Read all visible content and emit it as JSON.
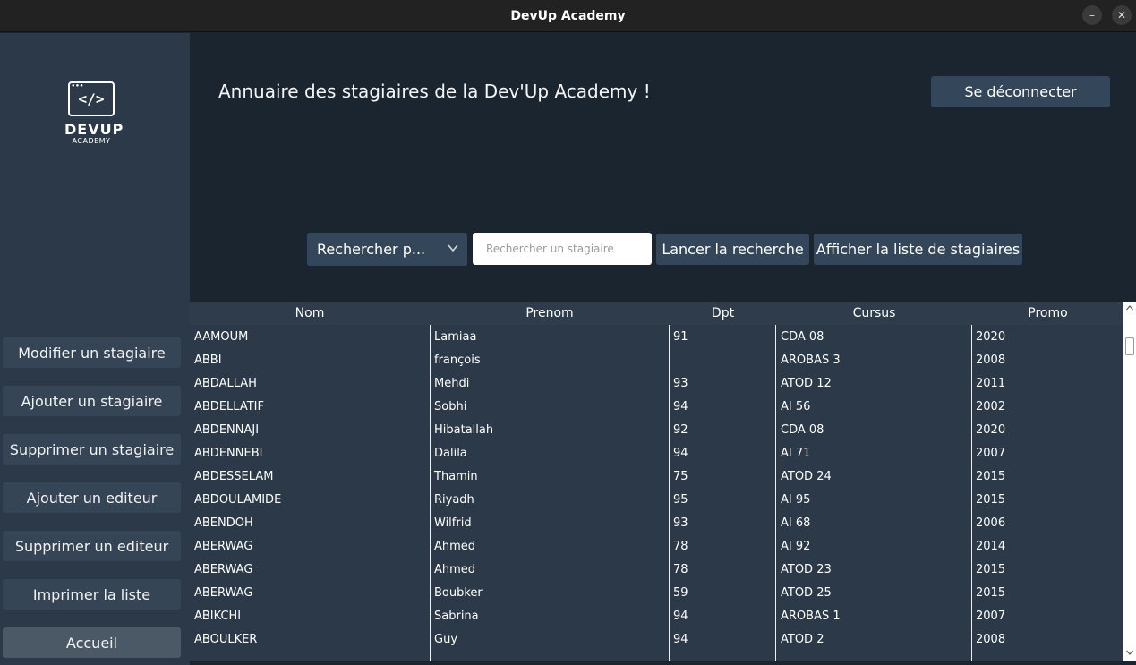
{
  "window": {
    "title": "DevUp Academy"
  },
  "sidebar": {
    "logo": {
      "code": "</>",
      "brand": "DEVUP",
      "sub": "ACADEMY"
    },
    "buttons": [
      {
        "label": "Modifier un stagiaire"
      },
      {
        "label": "Ajouter un stagiaire"
      },
      {
        "label": "Supprimer un stagiaire"
      },
      {
        "label": "Ajouter un editeur"
      },
      {
        "label": "Supprimer un editeur"
      },
      {
        "label": "Imprimer la liste"
      },
      {
        "label": "Accueil"
      }
    ]
  },
  "header": {
    "heading": "Annuaire des stagiaires de la Dev'Up Academy !",
    "logout_label": "Se déconnecter"
  },
  "search": {
    "select_value": "Rechercher p...",
    "input_placeholder": "Rechercher un stagiaire",
    "launch_label": "Lancer la recherche",
    "show_list_label": "Afficher la liste de stagiaires"
  },
  "table": {
    "columns": [
      "Nom",
      "Prenom",
      "Dpt",
      "Cursus",
      "Promo"
    ],
    "rows": [
      [
        "AAMOUM",
        "Lamiaa",
        "91",
        "CDA 08",
        "2020"
      ],
      [
        "ABBI",
        "françois",
        "",
        "AROBAS 3",
        "2008"
      ],
      [
        "ABDALLAH",
        "Mehdi",
        "93",
        "ATOD 12",
        "2011"
      ],
      [
        "ABDELLATIF",
        "Sobhi",
        "94",
        "AI 56",
        "2002"
      ],
      [
        "ABDENNAJI",
        "Hibatallah",
        "92",
        "CDA 08",
        "2020"
      ],
      [
        "ABDENNEBI",
        "Dalila",
        "94",
        "AI 71",
        "2007"
      ],
      [
        "ABDESSELAM",
        "Thamin",
        "75",
        "ATOD 24",
        "2015"
      ],
      [
        "ABDOULAMIDE",
        "Riyadh",
        "95",
        "AI 95",
        "2015"
      ],
      [
        "ABENDOH",
        "Wilfrid",
        "93",
        "AI 68",
        "2006"
      ],
      [
        "ABERWAG",
        "Ahmed",
        "78",
        "AI 92",
        "2014"
      ],
      [
        "ABERWAG",
        "Ahmed",
        "78",
        "ATOD 23",
        "2015"
      ],
      [
        "ABERWAG",
        "Boubker",
        "59",
        "ATOD 25",
        "2015"
      ],
      [
        "ABIKCHI",
        "Sabrina",
        "94",
        "AROBAS 1",
        "2007"
      ],
      [
        "ABOULKER",
        "Guy",
        "94",
        "ATOD 2",
        "2008"
      ]
    ]
  },
  "colors": {
    "sidebar_bg": "#2b3948",
    "main_bg": "#1a2530",
    "button_bg": "#34475a",
    "active_button_bg": "#4b5866",
    "titlebar_bg": "#222222"
  },
  "icons": [
    "minimize-icon",
    "close-icon",
    "chevron-down-icon",
    "scroll-up-icon",
    "scroll-down-icon"
  ]
}
